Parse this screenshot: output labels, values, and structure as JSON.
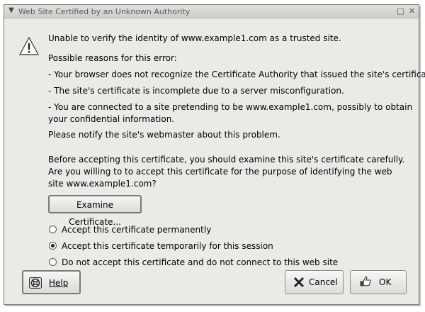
{
  "window": {
    "title": "Web Site Certified by an Unknown Authority"
  },
  "message": {
    "headline": "Unable to verify the identity of www.example1.com as a trusted site.",
    "reasons_heading": "Possible reasons for this error:",
    "reasons": [
      "- Your browser does not recognize the Certificate Authority that issued the site's certificate.",
      "- The site's certificate is incomplete due to a server misconfiguration.",
      "- You are connected to a site pretending to be www.example1.com, possibly to obtain your confidential information."
    ],
    "notify": "Please notify the site's webmaster about this problem.",
    "before_accepting": "Before accepting this certificate, you should examine this site's certificate carefully. Are you willing to to accept this certificate for the purpose of identifying the web site www.example1.com?"
  },
  "buttons": {
    "examine": "Examine Certificate...",
    "help": "Help",
    "cancel": "Cancel",
    "ok": "OK"
  },
  "options": [
    {
      "label": "Accept this certificate permanently",
      "selected": false
    },
    {
      "label": "Accept this certificate temporarily for this session",
      "selected": true
    },
    {
      "label": "Do not accept this certificate and do not connect to this web site",
      "selected": false
    }
  ],
  "icons": {
    "window_menu": "chevron-down-icon",
    "maximize": "maximize-icon",
    "close": "close-icon",
    "dialog": "warning-icon",
    "help": "help-lifebuoy-icon",
    "cancel": "cancel-x-icon",
    "ok": "ok-hand-icon"
  }
}
